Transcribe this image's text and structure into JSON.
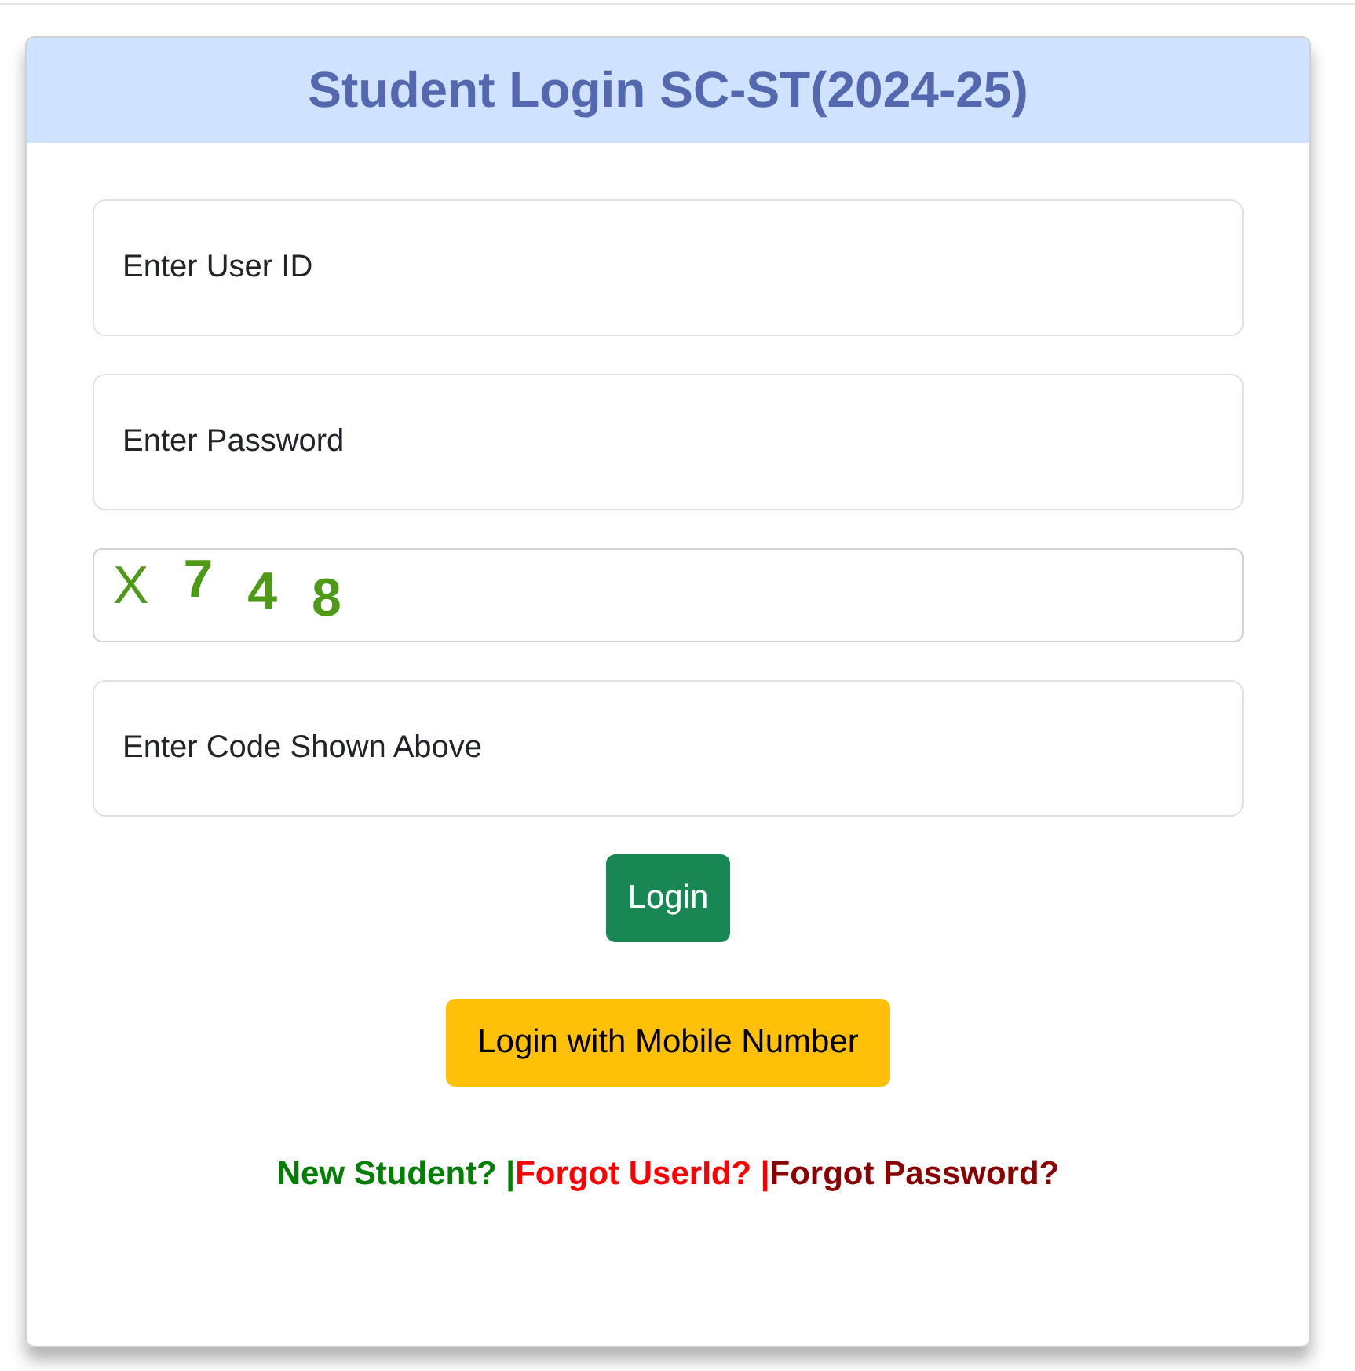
{
  "title": "Student Login SC-ST(2024-25)",
  "fields": [
    {
      "kind": "input",
      "placeholder": "Enter User ID"
    },
    {
      "kind": "input",
      "placeholder": "Enter Password"
    },
    {
      "kind": "captcha",
      "characters": [
        "X",
        "7",
        "4",
        "8"
      ]
    },
    {
      "kind": "input",
      "placeholder": "Enter Code Shown Above"
    }
  ],
  "buttons": [
    {
      "label": "Login",
      "color": "#198754"
    },
    {
      "label": "Login with Mobile Number",
      "color": "#ffc107"
    }
  ],
  "links": [
    {
      "text": "New Student? |",
      "color": "#008000"
    },
    {
      "text": "Forgot UserId? |",
      "color": "#ff0000"
    },
    {
      "text": "Forgot Password?",
      "color": "#8b0000"
    }
  ]
}
